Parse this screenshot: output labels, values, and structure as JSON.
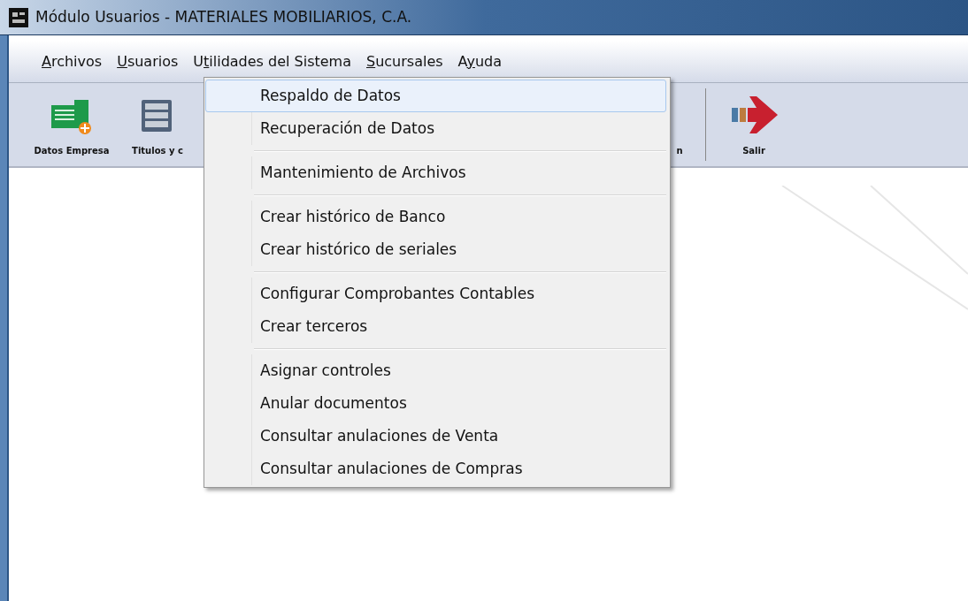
{
  "window": {
    "title": "Módulo Usuarios - MATERIALES MOBILIARIOS, C.A."
  },
  "menu_bar": [
    {
      "key": "A",
      "post": "rchivos"
    },
    {
      "key": "U",
      "post": "suarios"
    },
    {
      "pre": "U",
      "key": "t",
      "post": "ilidades del Sistema"
    },
    {
      "key": "S",
      "post": "ucursales"
    },
    {
      "pre": "A",
      "key": "y",
      "post": "uda"
    }
  ],
  "toolbar": [
    {
      "kind": "datos",
      "label": "Datos Empresa"
    },
    {
      "kind": "titulos",
      "label": "Titulos y c"
    },
    {
      "kind": "hidden",
      "label": "n"
    },
    {
      "kind": "separator"
    },
    {
      "kind": "salir",
      "label": "Salir"
    }
  ],
  "dropdown": [
    {
      "kind": "item",
      "label": "Respaldo de Datos",
      "selected": true
    },
    {
      "kind": "item",
      "label": "Recuperación de Datos",
      "selected": false
    },
    {
      "kind": "separator"
    },
    {
      "kind": "item",
      "label": "Mantenimiento de Archivos",
      "selected": false
    },
    {
      "kind": "separator"
    },
    {
      "kind": "item",
      "label": "Crear histórico de Banco",
      "selected": false
    },
    {
      "kind": "item",
      "label": "Crear histórico de seriales",
      "selected": false
    },
    {
      "kind": "separator"
    },
    {
      "kind": "item",
      "label": "Configurar Comprobantes Contables",
      "selected": false
    },
    {
      "kind": "item",
      "label": "Crear terceros",
      "selected": false
    },
    {
      "kind": "separator"
    },
    {
      "kind": "item",
      "label": "Asignar controles",
      "selected": false
    },
    {
      "kind": "item",
      "label": "Anular documentos",
      "selected": false
    },
    {
      "kind": "item",
      "label": "Consultar anulaciones de Venta",
      "selected": false
    },
    {
      "kind": "item",
      "label": "Consultar anulaciones de Compras",
      "selected": false
    }
  ]
}
